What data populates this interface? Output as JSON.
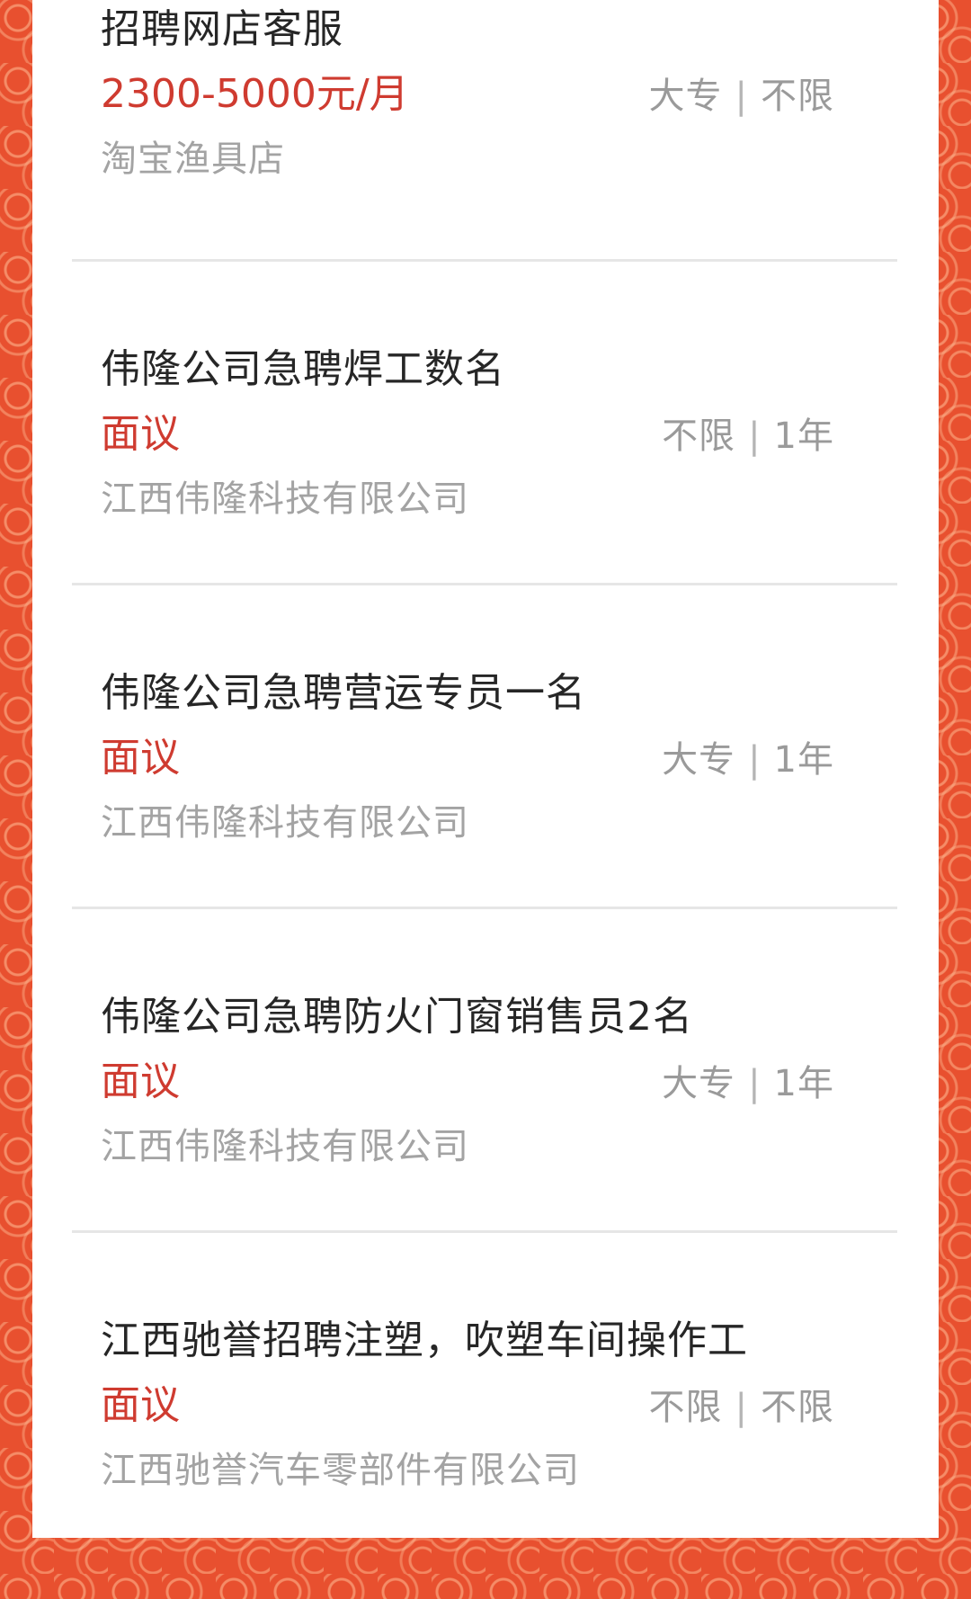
{
  "jobs": [
    {
      "title": "招聘网店客服",
      "salary": "2300-5000元/月",
      "education": "大专",
      "experience": "不限",
      "separator": "|",
      "company": "淘宝渔具店"
    },
    {
      "title": "伟隆公司急聘焊工数名",
      "salary": "面议",
      "education": "不限",
      "experience": "1年",
      "separator": "|",
      "company": "江西伟隆科技有限公司"
    },
    {
      "title": "伟隆公司急聘营运专员一名",
      "salary": "面议",
      "education": "大专",
      "experience": "1年",
      "separator": "|",
      "company": "江西伟隆科技有限公司"
    },
    {
      "title": "伟隆公司急聘防火门窗销售员2名",
      "salary": "面议",
      "education": "大专",
      "experience": "1年",
      "separator": "|",
      "company": "江西伟隆科技有限公司"
    },
    {
      "title": "江西驰誉招聘注塑，吹塑车间操作工",
      "salary": "面议",
      "education": "不限",
      "experience": "不限",
      "separator": "|",
      "company": "江西驰誉汽车零部件有限公司"
    }
  ],
  "colors": {
    "salary": "#cf3b30",
    "border_pattern": "#e8502f"
  }
}
